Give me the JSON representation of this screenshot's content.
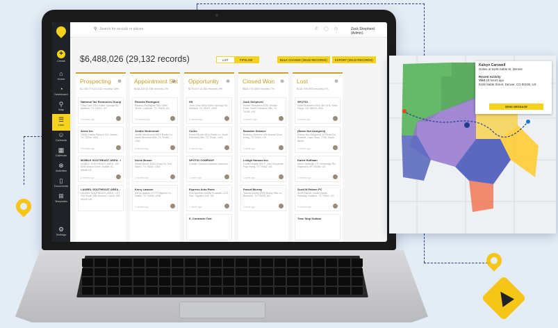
{
  "topbar": {
    "search_placeholder": "Search for records or places",
    "user_name": "Zack Shepherd (Admin)"
  },
  "sidebar": {
    "create_label": "Create",
    "items": [
      {
        "label": "Home",
        "icon": "home-icon",
        "glyph": "⌂"
      },
      {
        "label": "Dashboard",
        "icon": "dashboard-icon",
        "glyph": "◔"
      },
      {
        "label": "Map",
        "icon": "map-pin-icon",
        "glyph": "⚲"
      },
      {
        "label": "Lists",
        "icon": "list-icon",
        "glyph": "☰"
      },
      {
        "label": "Contacts",
        "icon": "contacts-icon",
        "glyph": "☺"
      },
      {
        "label": "Calendar",
        "icon": "calendar-icon",
        "glyph": "▦"
      },
      {
        "label": "Activities",
        "icon": "activities-icon",
        "glyph": "⊗"
      },
      {
        "label": "Documents",
        "icon": "documents-icon",
        "glyph": "▯"
      },
      {
        "label": "Templates",
        "icon": "templates-icon",
        "glyph": "⊞"
      }
    ],
    "settings_label": "Settings"
  },
  "main": {
    "total": "$6,488,026 (29,132 records)",
    "toggle": {
      "list": "LIST",
      "pipeline": "PIPELINE"
    },
    "bulk_change": "BULK CHANGE (29132 RECORDS)",
    "export": "EXPORT (29132 RECORDS)"
  },
  "columns": [
    {
      "title": "Prospecting",
      "color": "#c9a227",
      "summary": "$1,155,773 (10,111 records)  18%",
      "cards": [
        {
          "name": "National Tax Resources Group",
          "address": "Greg Garr\n3003 Keller Springs Rd, Addison, TX 75001, US",
          "time": "20 weeks ago"
        },
        {
          "name": "Acme Inc",
          "address": "16950 Dallas Pkwy # 202, Dallas, TX 75248, USA",
          "time": "15 weeks ago"
        },
        {
          "name": "MOBILE SOUTHEAST AREA - 007",
          "address": "MOBILE SOUTHEAST AREA - 007\n6350 Airport Drive, Mobile, AL 36608 US",
          "time": "8 months ago"
        },
        {
          "name": "LAUREL SOUTHEAST AREA - 007",
          "address": "LAUREL SOUTHEAST AREA - 007\n206 South 16th Avenue, Laurel, MS 39440 US",
          "time": ""
        }
      ]
    },
    {
      "title": "Appointment Set",
      "color": "#c9a227",
      "summary": "$138,320 (2,336 records)  2%",
      "cards": [
        {
          "name": "Ricardo Rodriguez",
          "address": "Ricardo Rodriguez\n3907 80th Street, Lubbock, TX 79424, US",
          "time": "10 months ago"
        },
        {
          "name": "Jenifer Mcdermott",
          "address": "Jenifer Mcdermott\n6919 Route Ln, North Richland Hills, TX 76180, USA",
          "time": "8 months ago"
        },
        {
          "name": "Derek Brown",
          "address": "Derek Brown\n8304 Cross Dr, Fort Worth, TX 76052, USA",
          "time": "3 months ago"
        },
        {
          "name": "Kerry Lawson",
          "address": "Kerry Lawson\n17772 Highline Ln, Dallas, TX 75248, USA",
          "time": "3 months ago"
        }
      ]
    },
    {
      "title": "Opportunity",
      "color": "#c9a227",
      "summary": "$276,870 (3,354 records)  4%",
      "cards": [
        {
          "name": "HS",
          "address": "John Cline\n5050 Keller Springs Rd, Addison, TX 75001, USA",
          "time": "6 months ago"
        },
        {
          "name": "Curtis",
          "address": "Robert Smith\n6914 Route Ln, North Richland Hills, TX 76180, USA",
          "time": "6 months ago"
        },
        {
          "name": "SPOTIO COMPANY",
          "address": "Charlie Chesson\nAddress unknown",
          "time": "1 month ago"
        },
        {
          "name": "Express Auto Parts",
          "address": "Ron\nAvenida Nueva Granada, CCS, Dtto. Capital 1041, VE",
          "time": "1 month ago"
        },
        {
          "name": "E. Contracts Test",
          "address": "",
          "time": ""
        }
      ]
    },
    {
      "title": "Closed Won",
      "color": "#c9a227",
      "summary": "$528,793 (593 records)  7%",
      "cards": [
        {
          "name": "Zack Shepherd",
          "address": "Hunter Shepherd\n8136 Terrace Drive, North Richland Hills, TX 76180, US",
          "time": "4 months ago"
        },
        {
          "name": "Brandon Selanee",
          "address": "Brandon Selanee\n446 Norma Drive, Irving, TX 75061, US",
          "time": "1 week ago"
        },
        {
          "name": "Lehigh Hanson Inc.",
          "address": "Curtis Roadie\n300 E John Carpenter Fwy, Irving, TX 75062, US",
          "time": "1 week ago"
        },
        {
          "name": "Pascal Murray",
          "address": "Pascal Murray\n4900 Brady Hills Ln, Burleson, TX 76028, US",
          "time": "1 week ago"
        }
      ]
    },
    {
      "title": "Lost",
      "color": "#c9a227",
      "summary": "$118,798 (903 records)  4%",
      "cards": [
        {
          "name": "SPOTIO",
          "address": "Zack Shepherd\n3924 4th St N, West Fargo, ND 58078, USA",
          "time": "1 month ago"
        },
        {
          "name": "(Name Not Assigned)",
          "address": "(Name Not Assigned)\n10 Pines Rd, Rowlett, Cape Town, 7700, South Africa",
          "time": "7 weeks ago"
        },
        {
          "name": "Karen Huffman",
          "address": "Karen Huffman\n272 Northridge Rd, Raymond, MT 59256, US",
          "time": "3 months ago"
        },
        {
          "name": "Scott M Palmer PC",
          "address": "Scott Palmer\n15455 Dallas Parkway, Addison, TX 75001, US",
          "time": "5 months ago"
        },
        {
          "name": "Time Stop Guitars",
          "address": "",
          "time": ""
        }
      ]
    }
  ],
  "map_popup": {
    "name": "Kalvyn Carswell",
    "status": "Online at 5108 Sable St, Denver",
    "recent_activity_title": "Recent Activity",
    "visit_label": "Visit",
    "visit_time": "10 hours ago",
    "visit_address": "5108 Sable Street, Denver, CO 80239, US",
    "send_button": "SEND MESSAGE"
  },
  "colors": {
    "accent": "#f5d31c",
    "sidebar": "#1f2226",
    "pin": "#f5c518",
    "dash": "#1f3d8f"
  }
}
